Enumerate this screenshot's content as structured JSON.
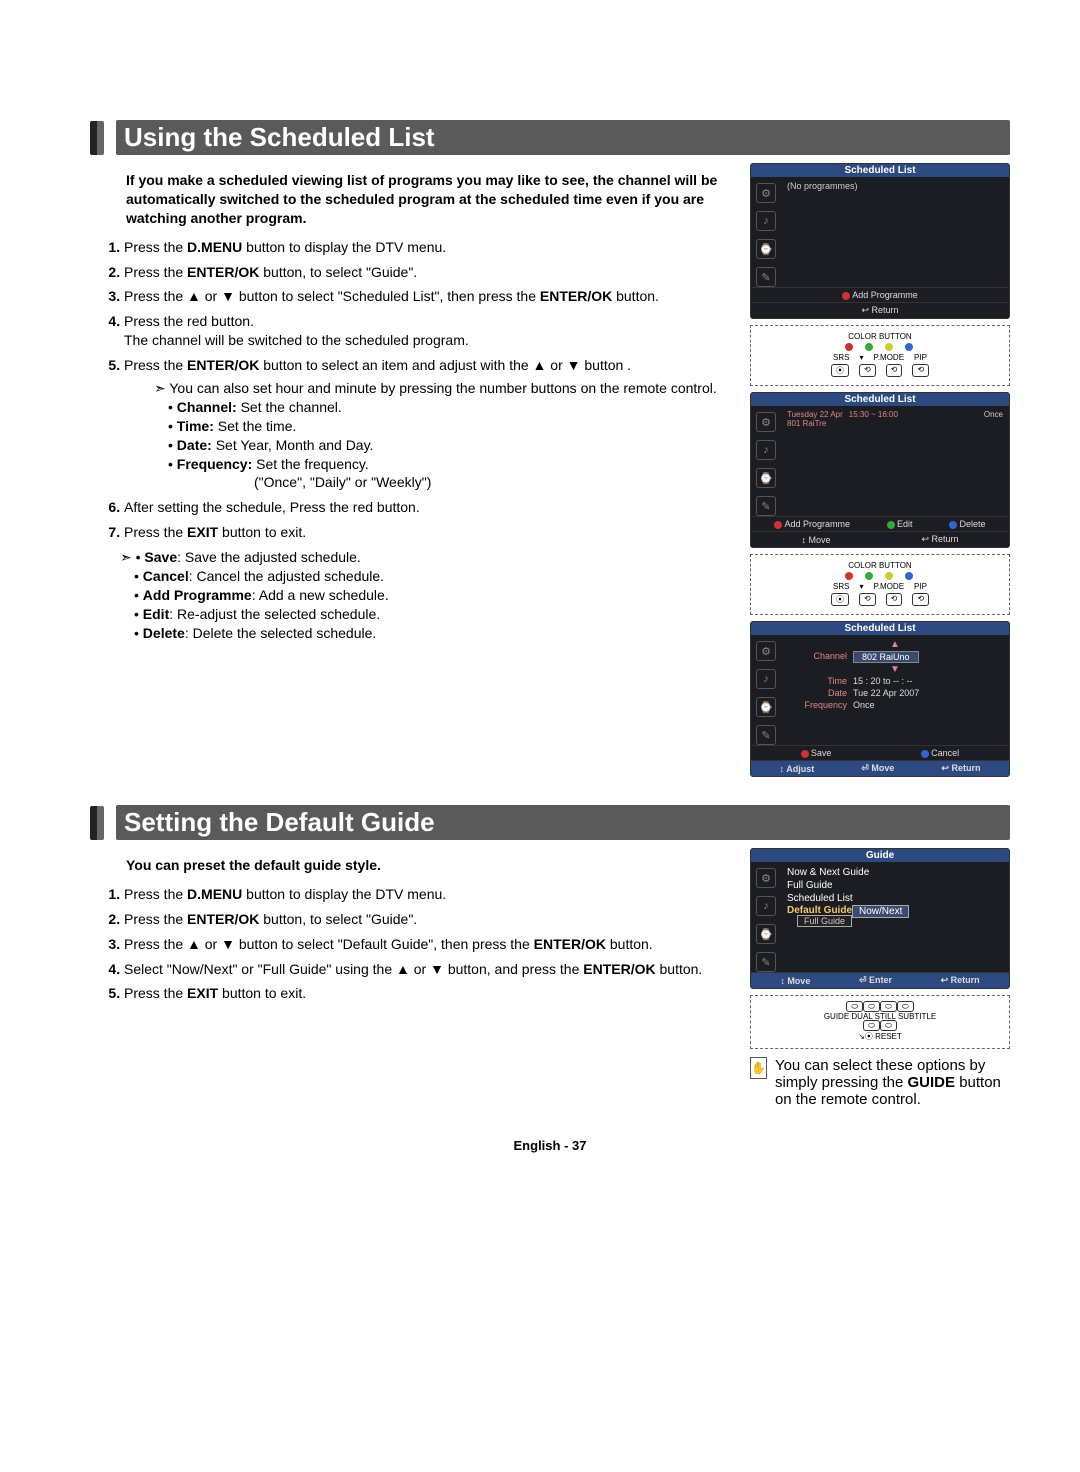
{
  "section1": {
    "title": "Using the Scheduled List",
    "intro": "If you make a scheduled viewing list of programs you may like to see, the channel will be automatically switched to the scheduled program at the scheduled time even if you are watching another program.",
    "steps": {
      "s1a": "Press the ",
      "s1b": "D.MENU",
      "s1c": " button to display the DTV menu.",
      "s2a": "Press the ",
      "s2b": "ENTER/OK",
      "s2c": " button, to select \"Guide\".",
      "s3a": "Press the ▲ or ▼ button to select \"Scheduled List\", then press the ",
      "s3b": "ENTER/OK",
      "s3c": " button.",
      "s4a": "Press the red button.",
      "s4b": "The channel will be switched to the scheduled program.",
      "s5a": "Press the ",
      "s5b": "ENTER/OK",
      "s5c": " button to select an item and adjust with the ▲ or ▼ button .",
      "s5_sub1": "You can also set hour and minute by pressing the number buttons on the remote control.",
      "s5_b1l": "Channel:",
      "s5_b1t": " Set the channel.",
      "s5_b2l": "Time:",
      "s5_b2t": " Set the time.",
      "s5_b3l": "Date:",
      "s5_b3t": " Set Year, Month and Day.",
      "s5_b4l": "Frequency:",
      "s5_b4t": " Set the frequency.",
      "s5_b4opts": "(\"Once\", \"Daily\" or \"Weekly\")",
      "s6": "After setting the schedule, Press the red button.",
      "s7a": "Press the ",
      "s7b": "EXIT",
      "s7c": " button to exit.",
      "save1l": "Save",
      "save1t": ": Save the adjusted schedule.",
      "save2l": "Cancel",
      "save2t": ": Cancel the adjusted schedule.",
      "save3l": "Add Programme",
      "save3t": ": Add a new schedule.",
      "save4l": "Edit",
      "save4t": ": Re-adjust the selected schedule.",
      "save5l": "Delete",
      "save5t": ": Delete the selected schedule."
    },
    "osd1": {
      "title": "Scheduled List",
      "no_prog": "(No programmes)",
      "foot_add": "Add Programme",
      "foot_ret": "↩ Return"
    },
    "remote1": {
      "cb": "COLOR BUTTON",
      "srs": "SRS",
      "pmode": "P.MODE",
      "pip": "PIP"
    },
    "osd2": {
      "title": "Scheduled List",
      "date": "Tuesday 22 Apr",
      "time": "15:30 ~ 16:00",
      "freq": "Once",
      "ch": "801 RaiTre",
      "f_add": "Add Programme",
      "f_edit": "Edit",
      "f_del": "Delete",
      "f_move": "↕ Move",
      "f_ret": "↩ Return"
    },
    "osd3": {
      "title": "Scheduled List",
      "ch_l": "Channel",
      "ch_v": "802 RaiUno",
      "tm_l": "Time",
      "tm_v": "15 : 20 to -- : --",
      "dt_l": "Date",
      "dt_v": "Tue 22 Apr 2007",
      "fr_l": "Frequency",
      "fr_v": "Once",
      "f_save": "Save",
      "f_cancel": "Cancel",
      "f_adj": "↕ Adjust",
      "f_move": "⏎ Move",
      "f_ret": "↩ Return"
    }
  },
  "section2": {
    "title": "Setting the Default Guide",
    "intro": "You can preset the default guide style.",
    "steps": {
      "s1a": "Press the ",
      "s1b": "D.MENU",
      "s1c": " button to display the DTV menu.",
      "s2a": "Press the ",
      "s2b": "ENTER/OK",
      "s2c": " button, to select \"Guide\".",
      "s3a": "Press the ▲ or ▼ button to select \"Default Guide\", then press the ",
      "s3b": "ENTER/OK",
      "s3c": " button.",
      "s4a": "Select \"Now/Next\" or \"Full Guide\" using the ▲ or ▼ button, and press the ",
      "s4b": "ENTER/OK",
      "s4c": " button.",
      "s5a": "Press the ",
      "s5b": "EXIT",
      "s5c": " button to exit."
    },
    "osd": {
      "title": "Guide",
      "item1": "Now & Next Guide",
      "item2": "Full Guide",
      "item3": "Scheduled List",
      "item4": "Default Guide",
      "opt1": "Now/Next",
      "opt2": "Full Guide",
      "f_move": "↕ Move",
      "f_enter": "⏎ Enter",
      "f_ret": "↩ Return"
    },
    "remote": {
      "guide": "GUIDE",
      "dual": "DUAL",
      "still": "STILL",
      "sub": "SUBTITLE",
      "reset": "⦿ RESET"
    },
    "note": "You can select these options by simply pressing the GUIDE button on the remote control.",
    "note_b": "GUIDE"
  },
  "footer": "English - 37"
}
